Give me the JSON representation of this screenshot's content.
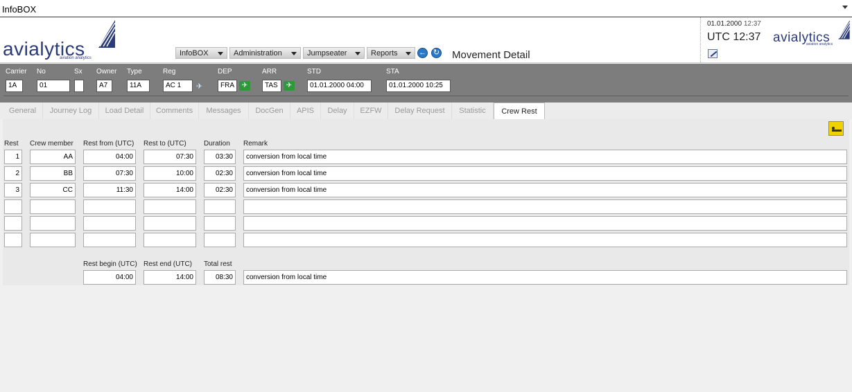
{
  "window": {
    "title": "InfoBOX"
  },
  "header": {
    "logo_word": "avialytics",
    "logo_sub": "aviation analytics",
    "menus": [
      "InfoBOX",
      "Administration",
      "Jumpseater",
      "Reports"
    ],
    "page_title": "Movement Detail",
    "date": "01.01.2000",
    "time": "12:37",
    "utc": "UTC 12:37"
  },
  "flight": {
    "labels": {
      "carrier": "Carrier",
      "no": "No",
      "sx": "Sx",
      "owner": "Owner",
      "type": "Type",
      "reg": "Reg",
      "dep": "DEP",
      "arr": "ARR",
      "std": "STD",
      "sta": "STA"
    },
    "values": {
      "carrier": "1A",
      "no": "01",
      "sx": "",
      "owner": "A7",
      "type": "11A",
      "reg": "AC 1",
      "dep": "FRA",
      "arr": "TAS",
      "std": "01.01.2000 04:00",
      "sta": "01.01.2000 10:25"
    }
  },
  "tabs": [
    "General",
    "Journey Log",
    "Load Detail",
    "Comments",
    "Messages",
    "DocGen",
    "APIS",
    "Delay",
    "EZFW",
    "Delay Request",
    "Statistic",
    "Crew Rest"
  ],
  "active_tab": "Crew Rest",
  "crew_rest": {
    "columns": [
      "Rest",
      "Crew member",
      "Rest from (UTC)",
      "Rest to (UTC)",
      "Duration",
      "Remark"
    ],
    "rows": [
      {
        "rest": "1",
        "crew": "AA",
        "from": "04:00",
        "to": "07:30",
        "duration": "03:30",
        "remark": "conversion from local time"
      },
      {
        "rest": "2",
        "crew": "BB",
        "from": "07:30",
        "to": "10:00",
        "duration": "02:30",
        "remark": "conversion from local time"
      },
      {
        "rest": "3",
        "crew": "CC",
        "from": "11:30",
        "to": "14:00",
        "duration": "02:30",
        "remark": "conversion from local time"
      },
      {
        "rest": "",
        "crew": "",
        "from": "",
        "to": "",
        "duration": "",
        "remark": ""
      },
      {
        "rest": "",
        "crew": "",
        "from": "",
        "to": "",
        "duration": "",
        "remark": ""
      },
      {
        "rest": "",
        "crew": "",
        "from": "",
        "to": "",
        "duration": "",
        "remark": ""
      }
    ],
    "totals_labels": {
      "begin": "Rest begin (UTC)",
      "end": "Rest end (UTC)",
      "total": "Total rest"
    },
    "totals": {
      "begin": "04:00",
      "end": "14:00",
      "total": "08:30",
      "remark": "conversion from local time"
    }
  },
  "icons": {
    "back": "back-arrow-icon",
    "refresh": "refresh-icon",
    "edit": "edit-icon",
    "bed": "crew-rest-bed-icon",
    "plane": "airplane-icon"
  }
}
